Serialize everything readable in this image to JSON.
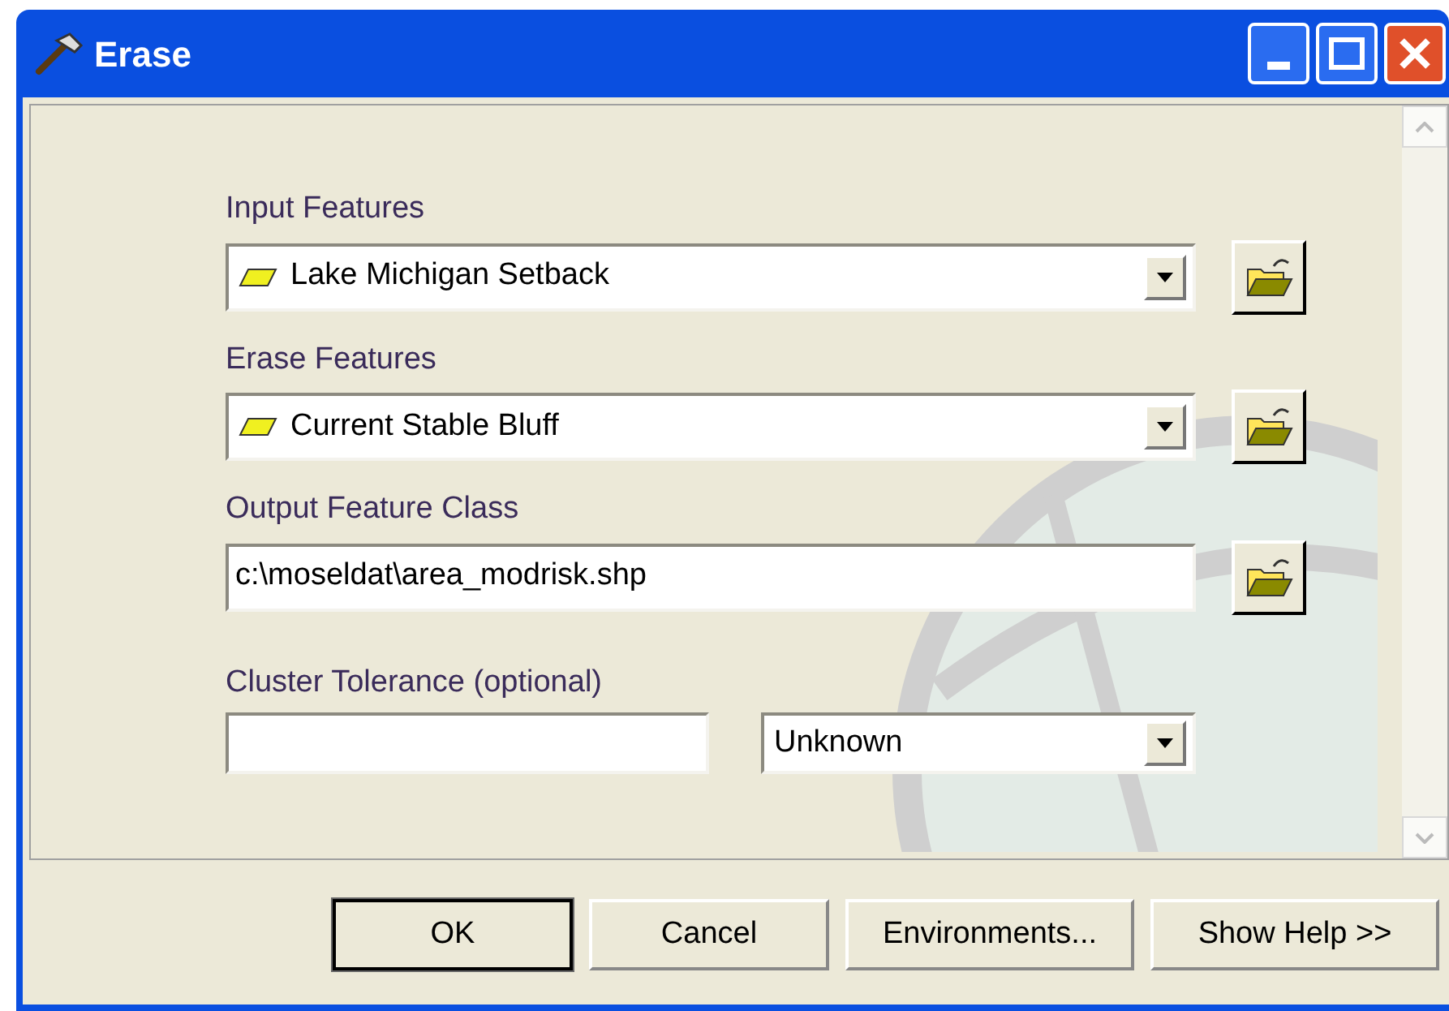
{
  "window": {
    "title": "Erase"
  },
  "parameters": [
    {
      "kind": "dataset",
      "label": "Input Features",
      "value": "Lake Michigan Setback"
    },
    {
      "kind": "dataset",
      "label": "Erase Features",
      "value": "Current Stable Bluff"
    },
    {
      "kind": "path",
      "label": "Output Feature Class",
      "value": "c:\\moseldat\\area_modrisk.shp"
    },
    {
      "kind": "tolerance",
      "label": "Cluster Tolerance (optional)",
      "unit": "Unknown"
    }
  ],
  "buttons": [
    {
      "label": "OK",
      "default": true
    },
    {
      "label": "Cancel",
      "default": false
    },
    {
      "label": "Environments...",
      "default": false
    },
    {
      "label": "Show Help >>",
      "default": false
    }
  ]
}
